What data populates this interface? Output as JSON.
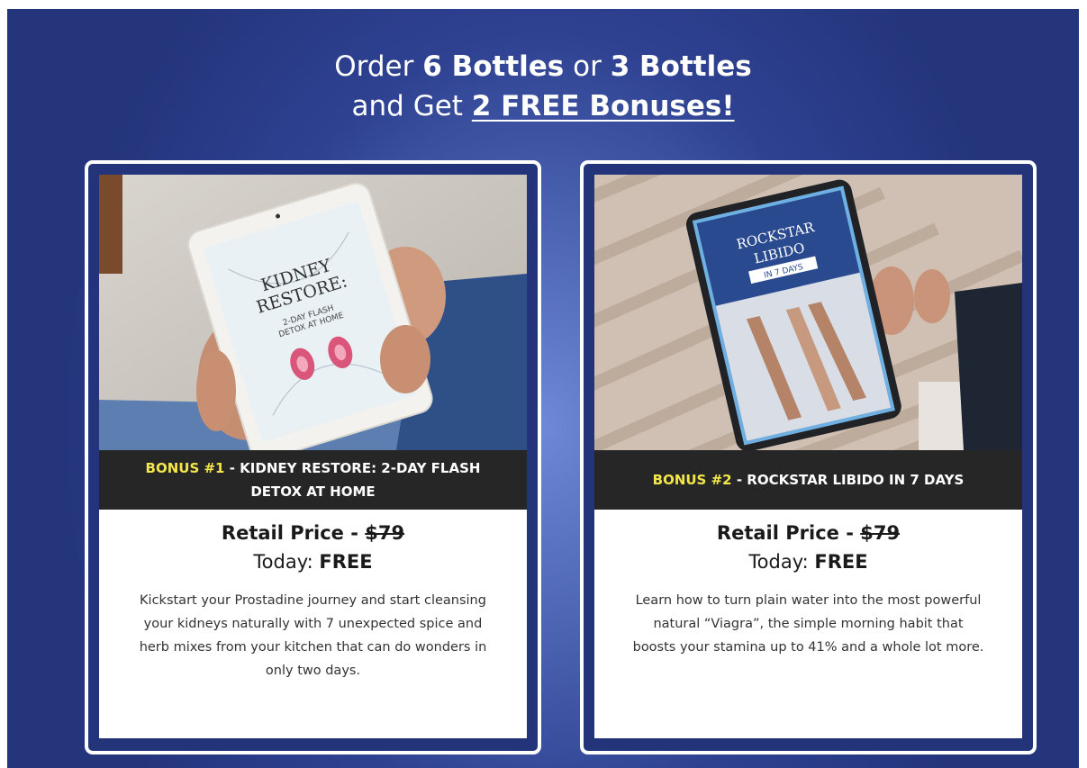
{
  "headline": {
    "line1_pre": "Order ",
    "line1_bold1": "6 Bottles",
    "line1_mid": " or ",
    "line1_bold2": "3 Bottles",
    "line2_pre": "and Get ",
    "line2_link": "2 FREE Bonuses!"
  },
  "bonuses": [
    {
      "tag": "BONUS #1",
      "title": " - KIDNEY RESTORE: 2-DAY FLASH DETOX AT HOME",
      "retail_label": "Retail Price - ",
      "retail_price": "$79",
      "today_label": "Today: ",
      "today_value": "FREE",
      "description": "Kickstart your Prostadine journey and start cleansing your kidneys naturally with 7 unexpected spice and herb mixes from your kitchen that can do wonders in only two days.",
      "cover": {
        "title_line1": "KIDNEY",
        "title_line2": "RESTORE:",
        "subtitle_line1": "2-DAY FLASH",
        "subtitle_line2": "DETOX AT HOME"
      }
    },
    {
      "tag": "BONUS #2",
      "title": " - ROCKSTAR LIBIDO IN 7 DAYS",
      "retail_label": "Retail Price - ",
      "retail_price": "$79",
      "today_label": "Today: ",
      "today_value": "FREE",
      "description": "Learn how to turn plain water into the most powerful natural “Viagra”, the simple morning habit that boosts your stamina up to 41% and a whole lot more.",
      "cover": {
        "title_line1": "ROCKSTAR",
        "title_line2": "LIBIDO",
        "subtitle_line1": "IN 7 DAYS"
      }
    }
  ],
  "colors": {
    "background": "#24357c",
    "banner": "#262626",
    "bonus_tag": "#f2e64b"
  }
}
